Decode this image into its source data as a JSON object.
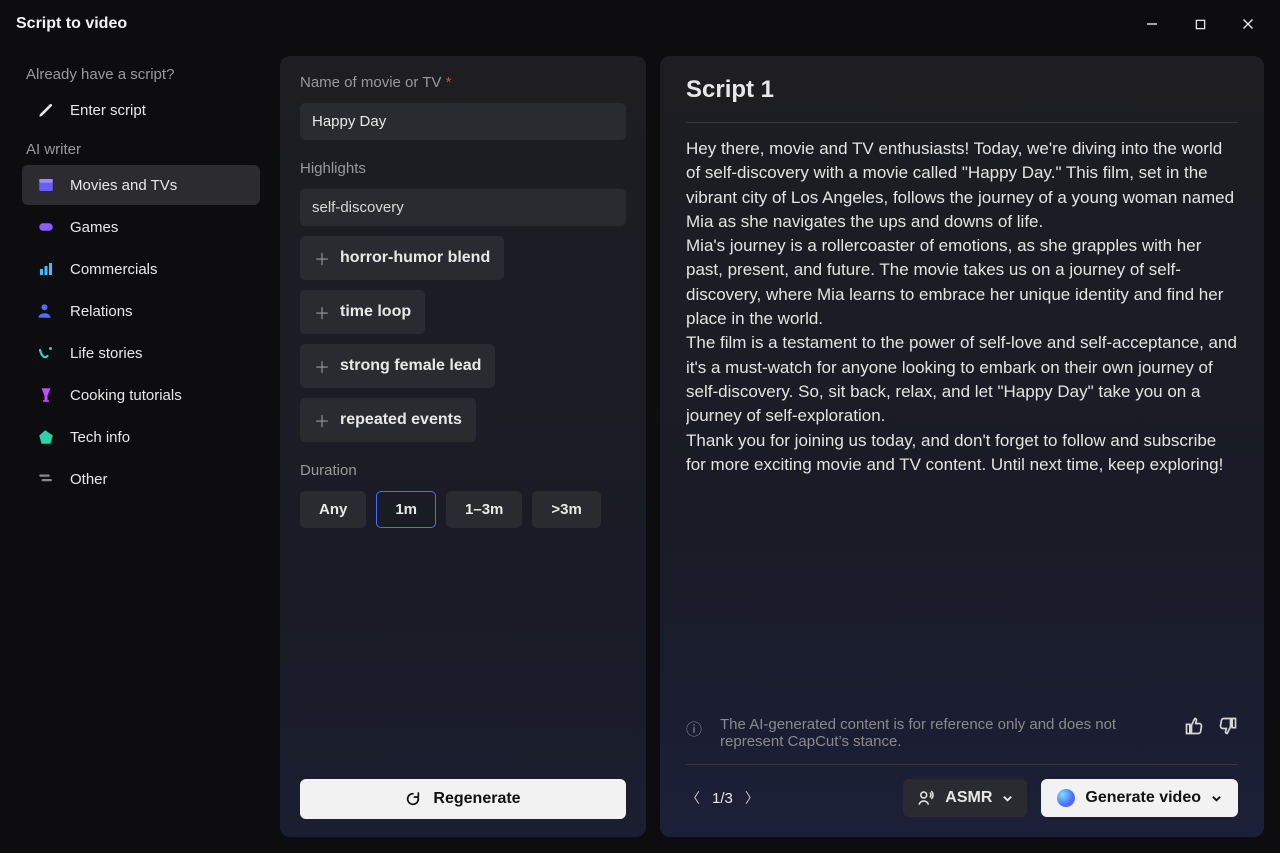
{
  "window": {
    "title": "Script to video"
  },
  "sidebar": {
    "script_section_label": "Already have a script?",
    "enter_script_label": "Enter script",
    "ai_writer_label": "AI writer",
    "items": [
      {
        "label": "Movies and TVs",
        "icon": "clapper",
        "selected": true
      },
      {
        "label": "Games",
        "icon": "controller",
        "selected": false
      },
      {
        "label": "Commercials",
        "icon": "chart",
        "selected": false
      },
      {
        "label": "Relations",
        "icon": "person",
        "selected": false
      },
      {
        "label": "Life stories",
        "icon": "wave",
        "selected": false
      },
      {
        "label": "Cooking tutorials",
        "icon": "glass",
        "selected": false
      },
      {
        "label": "Tech info",
        "icon": "tag",
        "selected": false
      },
      {
        "label": "Other",
        "icon": "other",
        "selected": false
      }
    ]
  },
  "form": {
    "name_label": "Name of movie or TV",
    "name_value": "Happy Day",
    "highlights_label": "Highlights",
    "highlight_primary": "self-discovery",
    "highlight_tags": [
      "horror-humor blend",
      "time loop",
      "strong female lead",
      "repeated events"
    ],
    "duration_label": "Duration",
    "duration_options": [
      "Any",
      "1m",
      "1–3m",
      ">3m"
    ],
    "duration_selected": "1m",
    "regenerate_label": "Regenerate"
  },
  "script": {
    "title": "Script 1",
    "body": "Hey there, movie and TV enthusiasts! Today, we're diving into the world of self-discovery with a movie called \"Happy Day.\" This film, set in the vibrant city of Los Angeles, follows the journey of a young woman named Mia as she navigates the ups and downs of life.\nMia's journey is a rollercoaster of emotions, as she grapples with her past, present, and future. The movie takes us on a journey of self-discovery, where Mia learns to embrace her unique identity and find her place in the world.\nThe film is a testament to the power of self-love and self-acceptance, and it's a must-watch for anyone looking to embark on their own journey of self-discovery. So, sit back, relax, and let \"Happy Day\" take you on a journey of self-exploration.\nThank you for joining us today, and don't forget to follow and subscribe for more exciting movie and TV content. Until next time, keep exploring!",
    "disclaimer": "The AI-generated content is for reference only and does not represent CapCut’s stance.",
    "page_current": 1,
    "page_total": 3,
    "voice_label": "ASMR",
    "generate_label": "Generate video"
  }
}
